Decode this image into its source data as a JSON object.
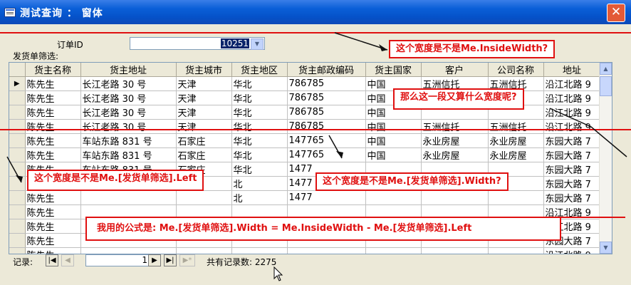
{
  "window": {
    "title": "测试查询 ： 窗体",
    "close_glyph": "✕"
  },
  "form": {
    "order_label": "订单ID",
    "order_value": "10251",
    "subform_label": "发货单筛选:"
  },
  "grid": {
    "columns": [
      "货主名称",
      "货主地址",
      "货主城市",
      "货主地区",
      "货主邮政编码",
      "货主国家",
      "客户",
      "公司名称",
      "地址"
    ],
    "rows": [
      {
        "name": "陈先生",
        "addr": "长江老路 30 号",
        "city": "天津",
        "region": "华北",
        "zip": "786785",
        "country": "中国",
        "cust": "五洲信托",
        "company": "五洲信托",
        "address": "沿江北路 9"
      },
      {
        "name": "陈先生",
        "addr": "长江老路 30 号",
        "city": "天津",
        "region": "华北",
        "zip": "786785",
        "country": "中国",
        "cust": "",
        "company": "",
        "address": "沿江北路 9"
      },
      {
        "name": "陈先生",
        "addr": "长江老路 30 号",
        "city": "天津",
        "region": "华北",
        "zip": "786785",
        "country": "中国",
        "cust": "",
        "company": "",
        "address": "沿江北路 9"
      },
      {
        "name": "陈先生",
        "addr": "长江老路 30 号",
        "city": "天津",
        "region": "华北",
        "zip": "786785",
        "country": "中国",
        "cust": "五洲信托",
        "company": "五洲信托",
        "address": "沿江北路 9"
      },
      {
        "name": "陈先生",
        "addr": "车站东路 831 号",
        "city": "石家庄",
        "region": "华北",
        "zip": "147765",
        "country": "中国",
        "cust": "永业房屋",
        "company": "永业房屋",
        "address": "东园大路 7"
      },
      {
        "name": "陈先生",
        "addr": "车站东路 831 号",
        "city": "石家庄",
        "region": "华北",
        "zip": "147765",
        "country": "中国",
        "cust": "永业房屋",
        "company": "永业房屋",
        "address": "东园大路 7"
      },
      {
        "name": "陈先生",
        "addr": "车站东路 831 号",
        "city": "石家庄",
        "region": "华北",
        "zip": "1477",
        "country": "",
        "cust": "",
        "company": "",
        "address": "东园大路 7"
      },
      {
        "name": "陈先生",
        "addr": "",
        "city": "",
        "region": "北",
        "zip": "1477",
        "country": "",
        "cust": "",
        "company": "",
        "address": "东园大路 7"
      },
      {
        "name": "陈先生",
        "addr": "",
        "city": "",
        "region": "北",
        "zip": "1477",
        "country": "",
        "cust": "",
        "company": "",
        "address": "东园大路 7"
      },
      {
        "name": "陈先生",
        "addr": "",
        "city": "",
        "region": "",
        "zip": "",
        "country": "",
        "cust": "",
        "company": "",
        "address": "沿江北路 9"
      },
      {
        "name": "陈先生",
        "addr": "",
        "city": "",
        "region": "",
        "zip": "",
        "country": "",
        "cust": "",
        "company": "",
        "address": "沿江北路 9"
      },
      {
        "name": "陈先生",
        "addr": "",
        "city": "",
        "region": "",
        "zip": "",
        "country": "",
        "cust": "",
        "company": "",
        "address": "东园大路 7"
      },
      {
        "name": "陈先生",
        "addr": "",
        "city": "",
        "region": "",
        "zip": "",
        "country": "",
        "cust": "",
        "company": "",
        "address": "沿江北路 9"
      }
    ],
    "current_row_marker": "▶"
  },
  "nav": {
    "record_label": "记录:",
    "current": "1",
    "total_label": "共有记录数: 2275",
    "first_glyph": "|◀",
    "prev_glyph": "◀",
    "next_glyph": "▶",
    "last_glyph": "▶|",
    "new_glyph": "▶*"
  },
  "annotations": {
    "inside_width": "这个宽度是不是Me.InsideWidth?",
    "what_width": "那么这一段又算什么宽度呢?",
    "left_q": "这个宽度是不是Me.[发货单筛选].Left",
    "width_q": "这个宽度是不是Me.[发货单筛选].Width?",
    "formula": "我用的公式是: Me.[发货单筛选].Width = Me.InsideWidth - Me.[发货单筛选].Left"
  },
  "colors": {
    "annotation": "#e01010",
    "titlebar": "#0a5fd8",
    "selection": "#0a246a"
  }
}
